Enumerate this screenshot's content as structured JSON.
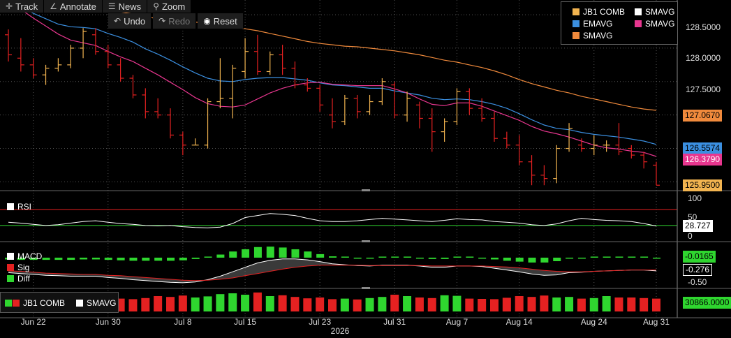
{
  "toolbar": {
    "track": "Track",
    "annotate": "Annotate",
    "news": "News",
    "zoom": "Zoom",
    "undo": "Undo",
    "redo": "Redo",
    "reset": "Reset"
  },
  "colors": {
    "bull": "#f2b450",
    "bear": "#e52121",
    "emavg": "#3b8fe0",
    "smavg_pink": "#e8368f",
    "smavg_orange": "#f08a3c",
    "white": "#ffffff",
    "green": "#2fd62f",
    "grid": "#555555"
  },
  "legend": {
    "jb1": "JB1 COMB",
    "smavg_w": "SMAVG",
    "emavg": "EMAVG",
    "smavg_p": "SMAVG",
    "smavg_o": "SMAVG"
  },
  "price_axis": {
    "ticks": [
      "128.5000",
      "128.0000",
      "127.5000"
    ],
    "badges": {
      "smavg_orange": "127.0670",
      "emavg": "126.5574",
      "smavg_pink": "126.3790",
      "last": "125.9500"
    }
  },
  "rsi": {
    "label": "RSI",
    "ticks": [
      "100",
      "50",
      "0"
    ],
    "value": "28.727"
  },
  "macd": {
    "label_macd": "MACD",
    "label_sig": "Sig",
    "label_diff": "Diff",
    "ticks": [
      "-0.50"
    ],
    "badge_diff": "-0.0165",
    "badge_sig": "-0.276"
  },
  "volume": {
    "label_jb1": "JB1 COMB",
    "label_smavg": "SMAVG",
    "badge": "30866.0000"
  },
  "xaxis": {
    "labels": [
      "Jun 22",
      "Jun 30",
      "Jul 8",
      "Jul 15",
      "Jul 23",
      "Jul 31",
      "Aug 7",
      "Aug 14",
      "Aug 24",
      "Aug 31"
    ],
    "year": "2026"
  },
  "chart_data": [
    {
      "type": "ohlc",
      "ylim": [
        125.9,
        128.72
      ],
      "x": [
        "Jun 18",
        "Jun 19",
        "Jun 22",
        "Jun 23",
        "Jun 24",
        "Jun 25",
        "Jun 26",
        "Jun 29",
        "Jun 30",
        "Jul 1",
        "Jul 2",
        "Jul 3",
        "Jul 6",
        "Jul 7",
        "Jul 8",
        "Jul 9",
        "Jul 10",
        "Jul 13",
        "Jul 14",
        "Jul 15",
        "Jul 16",
        "Jul 17",
        "Jul 20",
        "Jul 21",
        "Jul 22",
        "Jul 23",
        "Jul 24",
        "Jul 27",
        "Jul 28",
        "Jul 29",
        "Jul 30",
        "Jul 31",
        "Aug 3",
        "Aug 4",
        "Aug 5",
        "Aug 6",
        "Aug 7",
        "Aug 10",
        "Aug 11",
        "Aug 12",
        "Aug 13",
        "Aug 14",
        "Aug 17",
        "Aug 18",
        "Aug 19",
        "Aug 20",
        "Aug 21",
        "Aug 24",
        "Aug 25",
        "Aug 26",
        "Aug 27",
        "Aug 28",
        "Aug 31"
      ],
      "series": [
        {
          "open": 128.2,
          "high": 128.28,
          "low": 127.8,
          "close": 127.9
        },
        {
          "open": 127.85,
          "high": 128.15,
          "low": 127.65,
          "close": 127.75
        },
        {
          "open": 127.75,
          "high": 127.85,
          "low": 127.55,
          "close": 127.6
        },
        {
          "open": 127.6,
          "high": 127.75,
          "low": 127.45,
          "close": 127.7
        },
        {
          "open": 127.7,
          "high": 127.85,
          "low": 127.65,
          "close": 127.75
        },
        {
          "open": 127.75,
          "high": 128.05,
          "low": 127.7,
          "close": 128.0
        },
        {
          "open": 128.0,
          "high": 128.3,
          "low": 127.85,
          "close": 128.25
        },
        {
          "open": 128.2,
          "high": 128.3,
          "low": 127.9,
          "close": 127.95
        },
        {
          "open": 127.95,
          "high": 128.05,
          "low": 127.7,
          "close": 127.75
        },
        {
          "open": 127.75,
          "high": 127.85,
          "low": 127.5,
          "close": 127.55
        },
        {
          "open": 127.55,
          "high": 127.6,
          "low": 127.25,
          "close": 127.3
        },
        {
          "open": 127.3,
          "high": 127.4,
          "low": 126.95,
          "close": 127.05
        },
        {
          "open": 127.05,
          "high": 127.25,
          "low": 126.95,
          "close": 127.0
        },
        {
          "open": 127.0,
          "high": 127.1,
          "low": 126.65,
          "close": 126.7
        },
        {
          "open": 126.7,
          "high": 126.75,
          "low": 126.4,
          "close": 126.55
        },
        {
          "open": 126.55,
          "high": 126.65,
          "low": 126.55,
          "close": 126.55
        },
        {
          "open": 126.55,
          "high": 127.25,
          "low": 126.5,
          "close": 127.2
        },
        {
          "open": 127.2,
          "high": 127.85,
          "low": 127.1,
          "close": 127.25
        },
        {
          "open": 127.25,
          "high": 127.75,
          "low": 126.95,
          "close": 127.7
        },
        {
          "open": 127.65,
          "high": 128.15,
          "low": 127.55,
          "close": 127.95
        },
        {
          "open": 127.95,
          "high": 128.2,
          "low": 127.6,
          "close": 127.65
        },
        {
          "open": 127.65,
          "high": 127.95,
          "low": 127.6,
          "close": 127.9
        },
        {
          "open": 127.9,
          "high": 128.05,
          "low": 127.6,
          "close": 127.7
        },
        {
          "open": 127.7,
          "high": 127.8,
          "low": 127.4,
          "close": 127.45
        },
        {
          "open": 127.45,
          "high": 127.55,
          "low": 127.35,
          "close": 127.4
        },
        {
          "open": 127.4,
          "high": 127.45,
          "low": 127.05,
          "close": 127.15
        },
        {
          "open": 127.0,
          "high": 127.25,
          "low": 126.8,
          "close": 126.9
        },
        {
          "open": 126.9,
          "high": 127.3,
          "low": 126.85,
          "close": 127.25
        },
        {
          "open": 127.25,
          "high": 127.3,
          "low": 126.95,
          "close": 127.05
        },
        {
          "open": 127.05,
          "high": 127.3,
          "low": 127.0,
          "close": 127.2
        },
        {
          "open": 127.2,
          "high": 127.55,
          "low": 127.15,
          "close": 127.5
        },
        {
          "open": 127.45,
          "high": 127.5,
          "low": 126.95,
          "close": 127.0
        },
        {
          "open": 127.0,
          "high": 127.35,
          "low": 126.9,
          "close": 127.25
        },
        {
          "open": 127.15,
          "high": 127.2,
          "low": 126.8,
          "close": 126.95
        },
        {
          "open": 126.95,
          "high": 127.1,
          "low": 126.45,
          "close": 126.75
        },
        {
          "open": 126.75,
          "high": 126.95,
          "low": 126.6,
          "close": 126.9
        },
        {
          "open": 126.9,
          "high": 127.4,
          "low": 126.85,
          "close": 127.35
        },
        {
          "open": 127.35,
          "high": 127.4,
          "low": 127.0,
          "close": 127.1
        },
        {
          "open": 127.1,
          "high": 127.25,
          "low": 126.9,
          "close": 126.95
        },
        {
          "open": 126.95,
          "high": 127.05,
          "low": 126.6,
          "close": 126.65
        },
        {
          "open": 126.65,
          "high": 126.75,
          "low": 126.5,
          "close": 126.55
        },
        {
          "open": 126.55,
          "high": 126.7,
          "low": 126.25,
          "close": 126.3
        },
        {
          "open": 126.3,
          "high": 126.4,
          "low": 125.95,
          "close": 126.1
        },
        {
          "open": 126.1,
          "high": 126.25,
          "low": 125.95,
          "close": 126.05
        },
        {
          "open": 126.05,
          "high": 126.55,
          "low": 125.98,
          "close": 126.5
        },
        {
          "open": 126.5,
          "high": 126.88,
          "low": 126.45,
          "close": 126.8
        },
        {
          "open": 126.55,
          "high": 126.65,
          "low": 126.45,
          "close": 126.5
        },
        {
          "open": 126.5,
          "high": 126.7,
          "low": 126.4,
          "close": 126.55
        },
        {
          "open": 126.55,
          "high": 126.62,
          "low": 126.45,
          "close": 126.55
        },
        {
          "open": 126.55,
          "high": 126.88,
          "low": 126.4,
          "close": 126.45
        },
        {
          "open": 126.5,
          "high": 126.55,
          "low": 126.35,
          "close": 126.4
        },
        {
          "open": 126.4,
          "high": 126.45,
          "low": 126.2,
          "close": 126.3
        },
        {
          "open": 126.25,
          "high": 126.3,
          "low": 125.95,
          "close": 125.95
        }
      ],
      "ma_lines": [
        {
          "name": "EMAVG",
          "values": [
            128.7,
            128.62,
            128.52,
            128.44,
            128.36,
            128.32,
            128.31,
            128.29,
            128.22,
            128.16,
            128.09,
            127.99,
            127.91,
            127.82,
            127.72,
            127.63,
            127.55,
            127.51,
            127.5,
            127.53,
            127.55,
            127.56,
            127.56,
            127.54,
            127.52,
            127.48,
            127.45,
            127.44,
            127.42,
            127.4,
            127.4,
            127.36,
            127.33,
            127.3,
            127.25,
            127.23,
            127.24,
            127.23,
            127.2,
            127.16,
            127.1,
            127.02,
            126.93,
            126.85,
            126.8,
            126.78,
            126.74,
            126.71,
            126.69,
            126.67,
            126.64,
            126.61,
            126.56
          ]
        },
        {
          "name": "SMAVG",
          "values": [
            128.68,
            128.58,
            128.45,
            128.33,
            128.21,
            128.12,
            128.08,
            128.04,
            127.95,
            127.87,
            127.8,
            127.7,
            127.6,
            127.49,
            127.38,
            127.26,
            127.17,
            127.13,
            127.12,
            127.15,
            127.24,
            127.33,
            127.4,
            127.45,
            127.48,
            127.49,
            127.46,
            127.45,
            127.44,
            127.44,
            127.44,
            127.39,
            127.33,
            127.24,
            127.16,
            127.14,
            127.18,
            127.18,
            127.13,
            127.06,
            126.99,
            126.92,
            126.83,
            126.76,
            126.72,
            126.67,
            126.61,
            126.55,
            126.51,
            126.49,
            126.46,
            126.44,
            126.38
          ]
        },
        {
          "name": "SMAVG",
          "values": [
            128.88,
            128.85,
            128.82,
            128.78,
            128.74,
            128.7,
            128.66,
            128.62,
            128.58,
            128.54,
            128.51,
            128.47,
            128.44,
            128.42,
            128.41,
            128.39,
            128.37,
            128.34,
            128.32,
            128.29,
            128.26,
            128.22,
            128.18,
            128.14,
            128.1,
            128.07,
            128.05,
            128.03,
            128.02,
            128.0,
            127.98,
            127.96,
            127.93,
            127.9,
            127.86,
            127.82,
            127.79,
            127.75,
            127.71,
            127.66,
            127.6,
            127.53,
            127.47,
            127.42,
            127.37,
            127.33,
            127.28,
            127.24,
            127.2,
            127.16,
            127.12,
            127.09,
            127.07
          ]
        }
      ]
    },
    {
      "type": "line",
      "name": "RSI",
      "ylim": [
        0,
        100
      ],
      "values": [
        38,
        36,
        33,
        30,
        32,
        36,
        40,
        42,
        38,
        35,
        33,
        30,
        29,
        30,
        27,
        25,
        24,
        26,
        35,
        50,
        55,
        60,
        58,
        55,
        48,
        42,
        40,
        40,
        42,
        45,
        48,
        46,
        44,
        42,
        40,
        43,
        47,
        45,
        44,
        40,
        38,
        36,
        32,
        30,
        34,
        42,
        48,
        45,
        43,
        42,
        40,
        35,
        28.727
      ],
      "levels": [
        70,
        30
      ]
    },
    {
      "type": "bar",
      "name": "MACD",
      "macd": [
        -0.34,
        -0.36,
        -0.38,
        -0.4,
        -0.41,
        -0.42,
        -0.42,
        -0.42,
        -0.45,
        -0.47,
        -0.5,
        -0.52,
        -0.54,
        -0.56,
        -0.57,
        -0.55,
        -0.5,
        -0.42,
        -0.32,
        -0.22,
        -0.12,
        -0.06,
        -0.03,
        -0.03,
        -0.05,
        -0.09,
        -0.14,
        -0.16,
        -0.18,
        -0.19,
        -0.17,
        -0.17,
        -0.17,
        -0.19,
        -0.22,
        -0.22,
        -0.19,
        -0.19,
        -0.2,
        -0.24,
        -0.28,
        -0.32,
        -0.37,
        -0.4,
        -0.39,
        -0.34,
        -0.33,
        -0.31,
        -0.3,
        -0.29,
        -0.28,
        -0.28,
        -0.3
      ],
      "sig": [
        -0.3,
        -0.31,
        -0.33,
        -0.35,
        -0.36,
        -0.37,
        -0.38,
        -0.38,
        -0.4,
        -0.41,
        -0.43,
        -0.45,
        -0.47,
        -0.49,
        -0.51,
        -0.52,
        -0.51,
        -0.49,
        -0.46,
        -0.41,
        -0.36,
        -0.31,
        -0.26,
        -0.22,
        -0.19,
        -0.17,
        -0.17,
        -0.17,
        -0.17,
        -0.18,
        -0.18,
        -0.18,
        -0.18,
        -0.18,
        -0.19,
        -0.19,
        -0.19,
        -0.19,
        -0.19,
        -0.2,
        -0.21,
        -0.23,
        -0.26,
        -0.29,
        -0.31,
        -0.32,
        -0.32,
        -0.31,
        -0.3,
        -0.29,
        -0.28,
        -0.28,
        -0.28
      ],
      "diff": [
        -0.04,
        -0.05,
        -0.05,
        -0.05,
        -0.05,
        -0.05,
        -0.04,
        -0.04,
        -0.05,
        -0.06,
        -0.07,
        -0.07,
        -0.07,
        -0.07,
        -0.06,
        -0.03,
        0.01,
        0.07,
        0.14,
        0.19,
        0.24,
        0.25,
        0.23,
        0.19,
        0.14,
        0.08,
        0.03,
        0.01,
        -0.01,
        -0.01,
        0.01,
        0.01,
        0.01,
        -0.01,
        -0.03,
        -0.03,
        0.0,
        0.0,
        -0.01,
        -0.04,
        -0.07,
        -0.09,
        -0.11,
        -0.11,
        -0.08,
        -0.02,
        -0.01,
        0.0,
        0.0,
        0.0,
        0.0,
        0.0,
        -0.0165
      ]
    },
    {
      "type": "bar",
      "name": "JB1 COMB",
      "values": [
        48,
        52,
        45,
        50,
        47,
        55,
        58,
        60,
        50,
        46,
        44,
        48,
        55,
        52,
        57,
        50,
        54,
        62,
        65,
        60,
        68,
        55,
        58,
        52,
        47,
        50,
        44,
        46,
        43,
        48,
        52,
        60,
        55,
        50,
        48,
        58,
        56,
        46,
        45,
        44,
        49,
        55,
        52,
        57,
        50,
        52,
        46,
        48,
        55,
        50,
        50,
        48,
        46
      ]
    }
  ]
}
